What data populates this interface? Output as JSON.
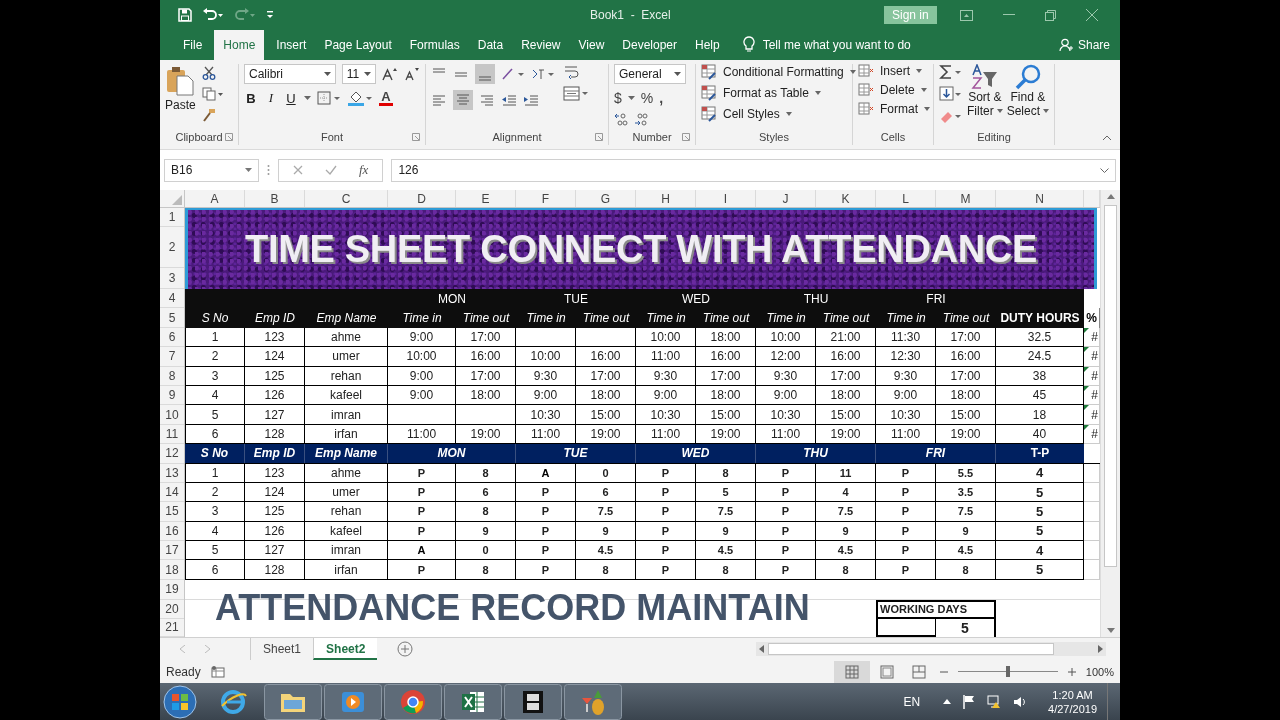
{
  "window": {
    "title": "Book1  -  Excel",
    "sign_in": "Sign in"
  },
  "ribbon_tabs": [
    {
      "label": "File",
      "selected": false
    },
    {
      "label": "Home",
      "selected": true
    },
    {
      "label": "Insert",
      "selected": false
    },
    {
      "label": "Page Layout",
      "selected": false
    },
    {
      "label": "Formulas",
      "selected": false
    },
    {
      "label": "Data",
      "selected": false
    },
    {
      "label": "Review",
      "selected": false
    },
    {
      "label": "View",
      "selected": false
    },
    {
      "label": "Developer",
      "selected": false
    },
    {
      "label": "Help",
      "selected": false
    }
  ],
  "tell_me": "Tell me what you want to do",
  "share": "Share",
  "clipboard": {
    "paste": "Paste",
    "label": "Clipboard"
  },
  "font": {
    "name": "Calibri",
    "size": "11",
    "bold": "B",
    "italic": "I",
    "underline": "U",
    "font_color_label": "A",
    "label": "Font"
  },
  "alignment": {
    "label": "Alignment"
  },
  "number": {
    "format": "General",
    "currency": "$",
    "percent": "%",
    "comma": ",",
    "label": "Number"
  },
  "styles": {
    "items": [
      "Conditional Formatting",
      "Format as Table",
      "Cell Styles"
    ],
    "label": "Styles"
  },
  "cells": {
    "items": [
      "Insert",
      "Delete",
      "Format"
    ],
    "label": "Cells"
  },
  "editing": {
    "sort": [
      "Sort &",
      "Filter"
    ],
    "find": [
      "Find &",
      "Select"
    ],
    "label": "Editing"
  },
  "formula_bar": {
    "name_box": "B16",
    "fx": "fx",
    "value": "126"
  },
  "columns": [
    "A",
    "B",
    "C",
    "D",
    "E",
    "F",
    "G",
    "H",
    "I",
    "J",
    "K",
    "L",
    "M",
    "N"
  ],
  "rows": [
    "1",
    "2",
    "3",
    "4",
    "5",
    "6",
    "7",
    "8",
    "9",
    "10",
    "11",
    "12",
    "13",
    "14",
    "15",
    "16",
    "17",
    "18",
    "19",
    "20",
    "21"
  ],
  "banner": "TIME SHEET CONNECT WITH ATTENDANCE",
  "timesheet": {
    "days": [
      "MON",
      "TUE",
      "WED",
      "THU",
      "FRI"
    ],
    "headers": [
      "S No",
      "Emp ID",
      "Emp Name",
      "Time in",
      "Time out",
      "Time in",
      "Time out",
      "Time in",
      "Time out",
      "Time in",
      "Time out",
      "Time in",
      "Time out",
      "DUTY HOURS"
    ],
    "pct_header": "%",
    "rows": [
      {
        "sno": "1",
        "id": "123",
        "name": "ahme",
        "times": [
          {
            "time_in": "9:00",
            "time_out": "17:00"
          },
          {
            "recorded": false
          },
          {
            "time_in": "10:00",
            "time_out": "18:00"
          },
          {
            "time_in": "10:00",
            "time_out": "21:00"
          },
          {
            "time_in": "11:30",
            "time_out": "17:00"
          }
        ],
        "duty": "32.5",
        "pct": "#"
      },
      {
        "sno": "2",
        "id": "124",
        "name": "umer",
        "times": [
          {
            "time_in": "10:00",
            "time_out": "16:00"
          },
          {
            "time_in": "10:00",
            "time_out": "16:00"
          },
          {
            "time_in": "11:00",
            "time_out": "16:00"
          },
          {
            "time_in": "12:00",
            "time_out": "16:00"
          },
          {
            "time_in": "12:30",
            "time_out": "16:00"
          }
        ],
        "duty": "24.5",
        "pct": "#"
      },
      {
        "sno": "3",
        "id": "125",
        "name": "rehan",
        "times": [
          {
            "time_in": "9:00",
            "time_out": "17:00"
          },
          {
            "time_in": "9:30",
            "time_out": "17:00"
          },
          {
            "time_in": "9:30",
            "time_out": "17:00"
          },
          {
            "time_in": "9:30",
            "time_out": "17:00"
          },
          {
            "time_in": "9:30",
            "time_out": "17:00"
          }
        ],
        "duty": "38",
        "pct": "#"
      },
      {
        "sno": "4",
        "id": "126",
        "name": "kafeel",
        "times": [
          {
            "time_in": "9:00",
            "time_out": "18:00"
          },
          {
            "time_in": "9:00",
            "time_out": "18:00"
          },
          {
            "time_in": "9:00",
            "time_out": "18:00"
          },
          {
            "time_in": "9:00",
            "time_out": "18:00"
          },
          {
            "time_in": "9:00",
            "time_out": "18:00"
          }
        ],
        "duty": "45",
        "pct": "#"
      },
      {
        "sno": "5",
        "id": "127",
        "name": "imran",
        "times": [
          {
            "recorded": false
          },
          {
            "time_in": "10:30",
            "time_out": "15:00"
          },
          {
            "time_in": "10:30",
            "time_out": "15:00"
          },
          {
            "time_in": "10:30",
            "time_out": "15:00"
          },
          {
            "time_in": "10:30",
            "time_out": "15:00"
          }
        ],
        "duty": "18",
        "pct": "#"
      },
      {
        "sno": "6",
        "id": "128",
        "name": "irfan",
        "times": [
          {
            "time_in": "11:00",
            "time_out": "19:00"
          },
          {
            "time_in": "11:00",
            "time_out": "19:00"
          },
          {
            "time_in": "11:00",
            "time_out": "19:00"
          },
          {
            "time_in": "11:00",
            "time_out": "19:00"
          },
          {
            "time_in": "11:00",
            "time_out": "19:00"
          }
        ],
        "duty": "40",
        "pct": "#"
      }
    ]
  },
  "attendance": {
    "headers": [
      "S No",
      "Emp ID",
      "Emp Name",
      "MON",
      "TUE",
      "WED",
      "THU",
      "FRI",
      "T-P"
    ],
    "rows": [
      {
        "sno": "1",
        "id": "123",
        "name": "ahme",
        "days": [
          {
            "status": "P",
            "hours": "8"
          },
          {
            "status": "A",
            "hours": "0"
          },
          {
            "status": "P",
            "hours": "8"
          },
          {
            "status": "P",
            "hours": "11"
          },
          {
            "status": "P",
            "hours": "5.5"
          }
        ],
        "tp": "4"
      },
      {
        "sno": "2",
        "id": "124",
        "name": "umer",
        "days": [
          {
            "status": "P",
            "hours": "6"
          },
          {
            "status": "P",
            "hours": "6"
          },
          {
            "status": "P",
            "hours": "5"
          },
          {
            "status": "P",
            "hours": "4"
          },
          {
            "status": "P",
            "hours": "3.5"
          }
        ],
        "tp": "5"
      },
      {
        "sno": "3",
        "id": "125",
        "name": "rehan",
        "days": [
          {
            "status": "P",
            "hours": "8"
          },
          {
            "status": "P",
            "hours": "7.5"
          },
          {
            "status": "P",
            "hours": "7.5"
          },
          {
            "status": "P",
            "hours": "7.5"
          },
          {
            "status": "P",
            "hours": "7.5"
          }
        ],
        "tp": "5"
      },
      {
        "sno": "4",
        "id": "126",
        "name": "kafeel",
        "days": [
          {
            "status": "P",
            "hours": "9"
          },
          {
            "status": "P",
            "hours": "9"
          },
          {
            "status": "P",
            "hours": "9"
          },
          {
            "status": "P",
            "hours": "9"
          },
          {
            "status": "P",
            "hours": "9"
          }
        ],
        "tp": "5"
      },
      {
        "sno": "5",
        "id": "127",
        "name": "imran",
        "days": [
          {
            "status": "A",
            "hours": "0"
          },
          {
            "status": "P",
            "hours": "4.5"
          },
          {
            "status": "P",
            "hours": "4.5"
          },
          {
            "status": "P",
            "hours": "4.5"
          },
          {
            "status": "P",
            "hours": "4.5"
          }
        ],
        "tp": "4"
      },
      {
        "sno": "6",
        "id": "128",
        "name": "irfan",
        "days": [
          {
            "status": "P",
            "hours": "8"
          },
          {
            "status": "P",
            "hours": "8"
          },
          {
            "status": "P",
            "hours": "8"
          },
          {
            "status": "P",
            "hours": "8"
          },
          {
            "status": "P",
            "hours": "8"
          }
        ],
        "tp": "5"
      }
    ]
  },
  "footer_title": "ATTENDANCE RECORD MAINTAIN",
  "working_days": {
    "label": "WORKING DAYS",
    "value": "5"
  },
  "sheet_tabs": [
    {
      "label": "Sheet1",
      "selected": false
    },
    {
      "label": "Sheet2",
      "selected": true
    }
  ],
  "status": {
    "text": "Ready",
    "zoom": "100%"
  },
  "zoom_slider": {
    "level": 0.5
  },
  "taskbar": {
    "language": "EN",
    "time": "1:20 AM",
    "date": "4/27/2019"
  }
}
